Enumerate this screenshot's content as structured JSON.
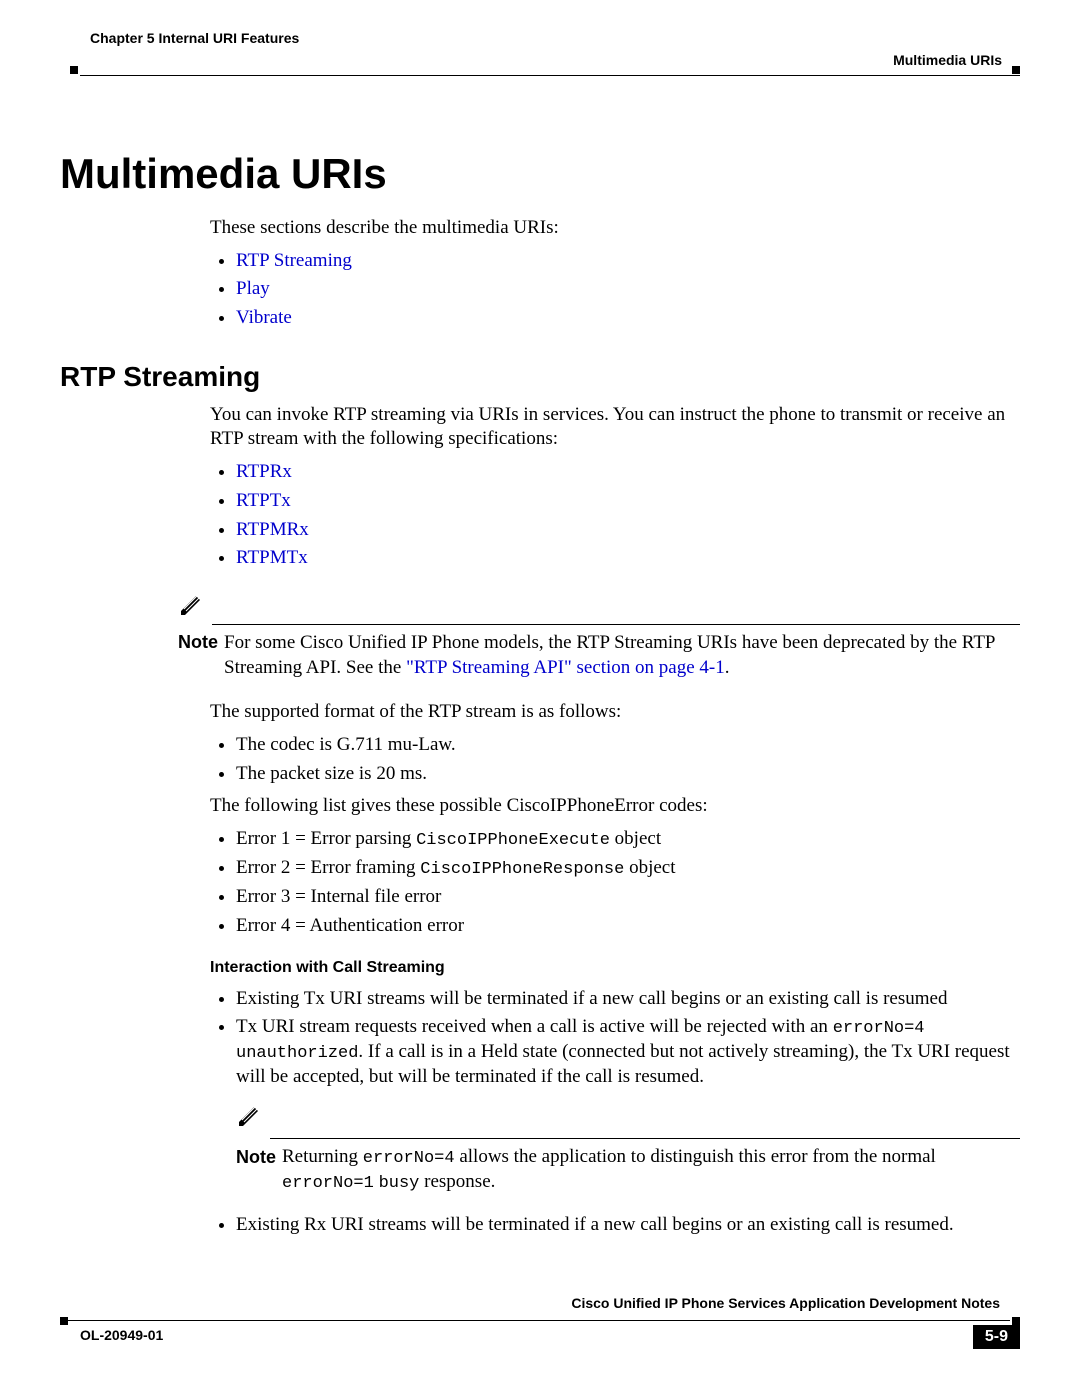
{
  "header": {
    "chapter": "Chapter 5      Internal URI Features",
    "section": "Multimedia URIs"
  },
  "h1": "Multimedia URIs",
  "intro_p": "These sections describe the multimedia URIs:",
  "intro_links": [
    "RTP Streaming",
    "Play",
    "Vibrate"
  ],
  "h2_rtp": "RTP Streaming",
  "rtp_p1": "You can invoke RTP streaming via URIs in services. You can instruct the phone to transmit or receive an RTP stream with the following specifications:",
  "rtp_links": [
    "RTPRx",
    "RTPTx",
    "RTPMRx",
    "RTPMTx"
  ],
  "note1_label": "Note",
  "note1_text_a": "For some Cisco Unified IP Phone models, the RTP Streaming URIs have been deprecated by the RTP Streaming API. See the ",
  "note1_link": "\"RTP Streaming API\" section on page 4-1",
  "note1_text_b": ".",
  "rtp_p2": "The supported format of the RTP stream is as follows:",
  "rtp_format": [
    "The codec is G.711 mu-Law.",
    "The packet size is 20 ms."
  ],
  "rtp_p3": "The following list gives these possible CiscoIPPhoneError codes:",
  "err": {
    "e1a": "Error 1 = Error parsing ",
    "e1code": "CiscoIPPhoneExecute",
    "e1b": " object",
    "e2a": "Error 2 = Error framing ",
    "e2code": "CiscoIPPhoneResponse",
    "e2b": " object",
    "e3": "Error 3 = Internal file error",
    "e4": "Error 4 = Authentication error"
  },
  "h3_interaction": "Interaction with Call Streaming",
  "int": {
    "b1": "Existing Tx URI streams will be terminated if a new call begins or an existing call is resumed",
    "b2a": "Tx URI stream requests received when a call is active will be rejected with an ",
    "b2code1": "errorNo=4",
    "b2b": " ",
    "b2code2": "unauthorized",
    "b2c": ". If a call is in a Held state (connected but not actively streaming), the Tx URI request will be accepted, but will be terminated if the call is resumed.",
    "note2_label": "Note",
    "note2_a": "Returning ",
    "note2_code1": "errorNo=4",
    "note2_b": " allows the application to distinguish this error from the normal ",
    "note2_code2": "errorNo=1",
    "note2_c": " ",
    "note2_code3": "busy",
    "note2_d": " response.",
    "b3": "Existing Rx URI streams will be terminated if a new call begins or an existing call is resumed."
  },
  "footer": {
    "title": "Cisco Unified IP Phone Services Application Development Notes",
    "ol": "OL-20949-01",
    "page": "5-9"
  }
}
